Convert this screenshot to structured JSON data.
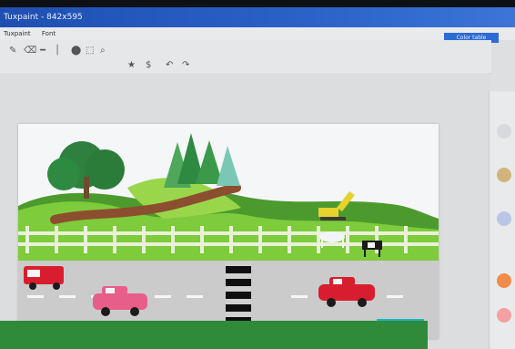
{
  "window": {
    "title": "Tuxpaint - 842x595",
    "menu": [
      "Tuxpaint",
      "Font"
    ]
  },
  "toolbar": {
    "tools": [
      {
        "name": "pencil-icon",
        "glyph": "✎"
      },
      {
        "name": "eraser-icon",
        "glyph": "⌫"
      },
      {
        "name": "line-icon",
        "glyph": "━"
      },
      {
        "name": "vertical-line-icon",
        "glyph": "│"
      },
      {
        "name": "stamp-icon",
        "glyph": "⬤"
      },
      {
        "name": "select-icon",
        "glyph": "⬚"
      },
      {
        "name": "zoom-icon",
        "glyph": "⌕"
      },
      {
        "name": "star-icon",
        "glyph": "★"
      },
      {
        "name": "dollar-icon",
        "glyph": "$"
      },
      {
        "name": "undo-icon",
        "glyph": "↶"
      },
      {
        "name": "redo-icon",
        "glyph": "↷"
      }
    ],
    "right_tab": "Color table"
  },
  "colors": {
    "titlebar": "#2a62c9",
    "sky": "#f4f6f8",
    "grass_light": "#7ecb3b",
    "grass_dark": "#3d8d2d",
    "road": "#cbcbcb",
    "fence": "#e9f1d8"
  }
}
